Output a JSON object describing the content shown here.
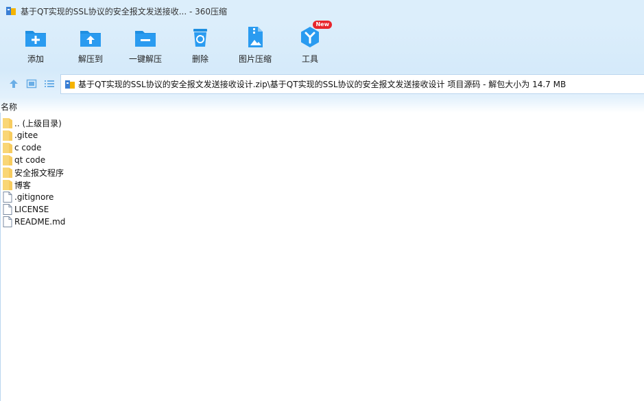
{
  "window": {
    "title": "基于QT实现的SSL协议的安全报文发送接收... - 360压缩"
  },
  "toolbar": {
    "items": [
      {
        "label": "添加",
        "icon": "add-folder-icon"
      },
      {
        "label": "解压到",
        "icon": "extract-to-icon"
      },
      {
        "label": "一键解压",
        "icon": "one-click-extract-icon"
      },
      {
        "label": "删除",
        "icon": "recycle-bin-icon"
      },
      {
        "label": "图片压缩",
        "icon": "image-compress-icon"
      },
      {
        "label": "工具",
        "icon": "tools-icon",
        "badge": "New"
      }
    ]
  },
  "address": {
    "path": "基于QT实现的SSL协议的安全报文发送接收设计.zip\\基于QT实现的SSL协议的安全报文发送接收设计 项目源码 - 解包大小为 14.7 MB"
  },
  "columns": {
    "name": "名称"
  },
  "files": [
    {
      "name": ".. (上级目录)",
      "type": "folder"
    },
    {
      "name": ".gitee",
      "type": "folder"
    },
    {
      "name": "c code",
      "type": "folder"
    },
    {
      "name": "qt code",
      "type": "folder"
    },
    {
      "name": "安全报文程序",
      "type": "folder"
    },
    {
      "name": "博客",
      "type": "folder"
    },
    {
      "name": ".gitignore",
      "type": "file"
    },
    {
      "name": "LICENSE",
      "type": "file"
    },
    {
      "name": "README.md",
      "type": "file"
    }
  ],
  "colors": {
    "accent": "#1e8fe1",
    "folder": "#f7cc5f",
    "badge": "#e8262c"
  }
}
